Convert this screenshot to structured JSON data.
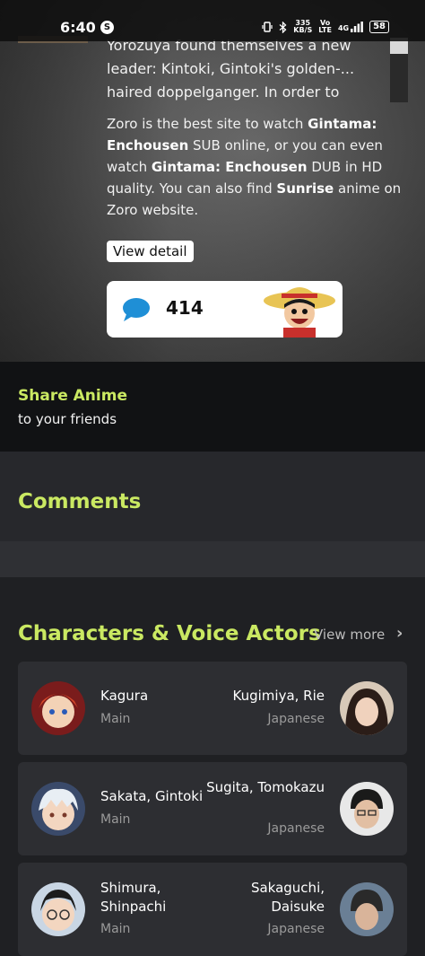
{
  "status_bar": {
    "time": "6:40",
    "app_icon": "shazam-icon",
    "net_speed": "335",
    "net_unit": "KB/S",
    "volte": "Vo",
    "lte": "LTE",
    "signal": "4G",
    "battery": "58"
  },
  "synopsis": {
    "lines": [
      "Yorozuya found themselves a new",
      "leader: Kintoki, Gintoki's golden-...",
      "haired doppelganger. In order to"
    ]
  },
  "info": {
    "p1": "Zoro is the best site to watch ",
    "title1": "Gintama: Enchousen",
    "p2": " SUB online, or you can even watch ",
    "title2": "Gintama: Enchousen",
    "p3": " DUB in HD quality. You can also find ",
    "studio": "Sunrise",
    "p4": " anime on Zoro website."
  },
  "view_detail_label": "View detail",
  "comments_widget": {
    "count": "414"
  },
  "share": {
    "title": "Share Anime",
    "subtitle": "to your friends"
  },
  "comments_section": {
    "title": "Comments"
  },
  "characters": {
    "title": "Characters & Voice Actors",
    "view_more": "View more",
    "items": [
      {
        "name": "Kagura",
        "role": "Main",
        "actor": "Kugimiya, Rie",
        "language": "Japanese"
      },
      {
        "name": "Sakata, Gintoki",
        "role": "Main",
        "actor": "Sugita, Tomokazu",
        "language": "Japanese"
      },
      {
        "name": "Shimura, Shinpachi",
        "role": "Main",
        "actor": "Sakaguchi, Daisuke",
        "language": "Japanese"
      }
    ]
  },
  "colors": {
    "accent": "#cae962",
    "background": "#1f2023",
    "card": "#2d2e32",
    "comment_icon": "#1f8fd6"
  }
}
